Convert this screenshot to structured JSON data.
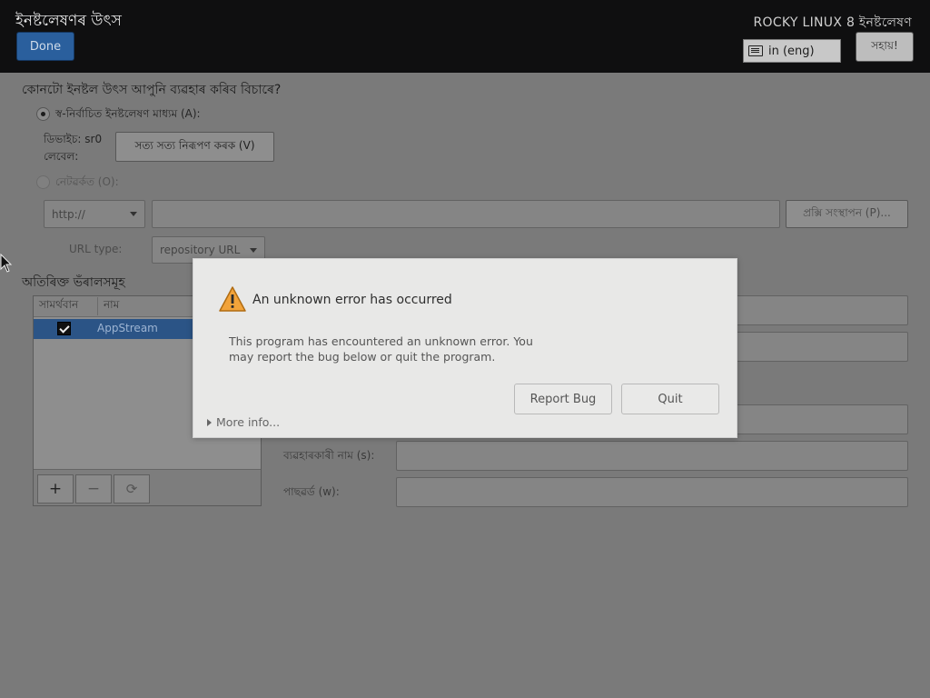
{
  "header": {
    "title": "ইনষ্টলেষণৰ উৎস",
    "done_label": "Done",
    "product": "ROCKY LINUX 8 ইনষ্টলেষণ",
    "keyboard_layout": "in (eng)",
    "help_label": "সহায়!"
  },
  "main": {
    "question": "কোনটো ইনষ্টল উৎস আপুনি ব্যৱহাৰ কৰিব বিচাৰে?",
    "auto_media_label": "স্ব-নিৰ্বাচিত ইনষ্টলেষণ মাধ্যম (A):",
    "device_label": "ডিভাইচ: sr0",
    "label_label": "লেবেল:",
    "verify_button": "সত্য সত্য নিৰূপণ কৰক (V)",
    "network_label": "নেটৱৰ্কত (O):",
    "protocol": "http://",
    "url_value": "",
    "proxy_button": "প্ৰক্সি সংস্থাপন (P)...",
    "url_type_label": "URL type:",
    "url_type_value": "repository URL"
  },
  "repos": {
    "heading": "অতিৰিক্ত ভঁৰালসমূহ",
    "columns": [
      "সামৰ্থবান",
      "নাম"
    ],
    "items": [
      {
        "enabled": true,
        "name": "AppStream"
      }
    ],
    "toolbar": {
      "add": "+",
      "remove": "−",
      "refresh": "⟳"
    }
  },
  "repo_form": {
    "username_label": "ব্যৱহাৰকাৰী নাম (s):",
    "password_label": "পাছৱৰ্ড (w):"
  },
  "dialog": {
    "title": "An unknown error has occurred",
    "message": "This program has encountered an unknown error. You may report the bug below or quit the program.",
    "report_label": "Report Bug",
    "quit_label": "Quit",
    "more_info": "More info..."
  },
  "colors": {
    "header_bg": "#0f0f10",
    "done_button": "#2a5f9d",
    "selected_row": "#2b5486",
    "dimmed_bg": "#7a7a7a",
    "dialog_bg": "#e8e8e7",
    "warning": "#f2a33a"
  }
}
